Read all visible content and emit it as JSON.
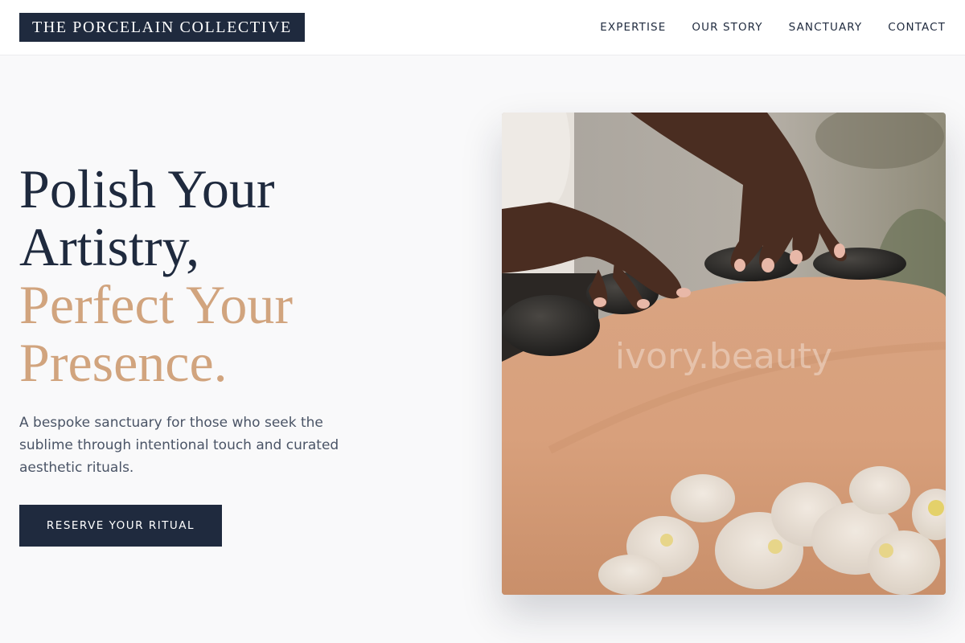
{
  "brand": {
    "logo_text": "THE PORCELAIN COLLECTIVE"
  },
  "nav": {
    "items": [
      {
        "label": "EXPERTISE"
      },
      {
        "label": "OUR STORY"
      },
      {
        "label": "SANCTUARY"
      },
      {
        "label": "CONTACT"
      }
    ]
  },
  "hero": {
    "headline_line1": "Polish Your",
    "headline_line2": "Artistry,",
    "headline_line3": "Perfect Your",
    "headline_line4": "Presence.",
    "subtitle": "A bespoke sanctuary for those who seek the sublime through intentional touch and curated aesthetic rituals.",
    "cta_label": "RESERVE YOUR RITUAL",
    "image_watermark": "ivory.beauty"
  },
  "colors": {
    "navy": "#1f2a3e",
    "accent": "#d1a47e",
    "background": "#f9f9fa"
  }
}
